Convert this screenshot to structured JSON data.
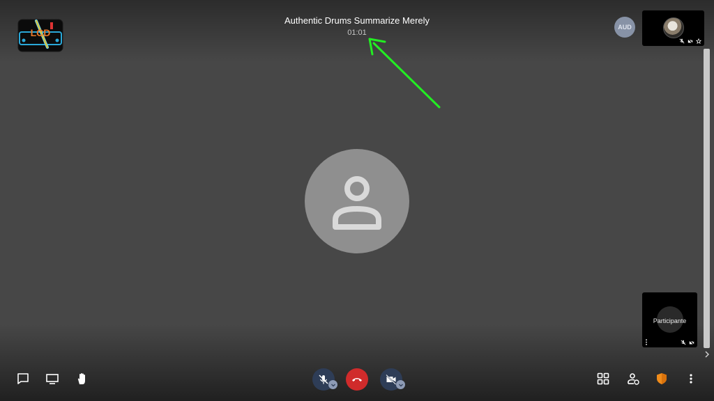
{
  "meeting": {
    "title": "Authentic Drums Summarize Merely",
    "timer": "01:01"
  },
  "logo": {
    "text": "LCD"
  },
  "audience_badge": "AUD",
  "participant_tile": {
    "name": "Participante"
  },
  "colors": {
    "background": "#474747",
    "hangup": "#d02b2b",
    "control_bg": "#2e3d57",
    "annotation_arrow": "#22ee22",
    "security_shield": "#f08c1a"
  },
  "icons": {
    "toolbar_left": [
      "chat-icon",
      "screen-share-icon",
      "raise-hand-icon"
    ],
    "toolbar_center": [
      "microphone-muted-icon",
      "hangup-icon",
      "camera-off-icon"
    ],
    "toolbar_right": [
      "tile-view-icon",
      "invite-participant-icon",
      "security-shield-icon",
      "more-options-icon"
    ]
  }
}
